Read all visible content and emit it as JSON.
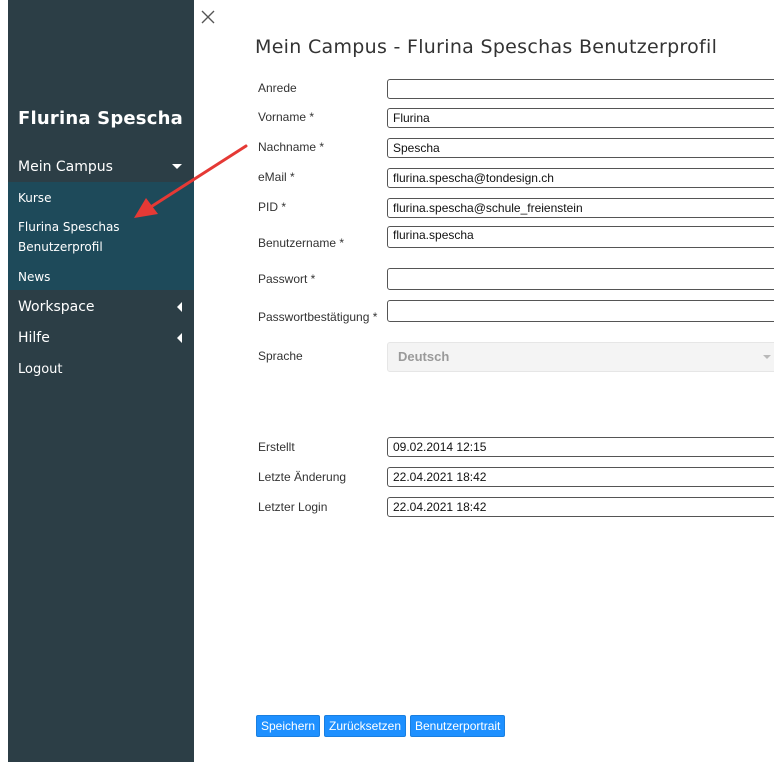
{
  "sidebar": {
    "user_name": "Flurina Spescha",
    "menu": [
      {
        "label": "Mein Campus",
        "expanded": true
      },
      {
        "label": "Kurse"
      },
      {
        "label": "Flurina Speschas Benutzerprofil"
      },
      {
        "label": "News"
      },
      {
        "label": "Workspace",
        "expanded": false
      },
      {
        "label": "Hilfe",
        "expanded": false
      },
      {
        "label": "Logout"
      }
    ]
  },
  "page": {
    "title": "Mein Campus - Flurina Speschas Benutzerprofil"
  },
  "form": {
    "anrede": {
      "label": "Anrede",
      "value": ""
    },
    "vorname": {
      "label": "Vorname *",
      "value": "Flurina"
    },
    "nachname": {
      "label": "Nachname *",
      "value": "Spescha"
    },
    "email": {
      "label": "eMail *",
      "value": "flurina.spescha@tondesign.ch"
    },
    "pid": {
      "label": "PID *",
      "value": "flurina.spescha@schule_freienstein"
    },
    "benutzername": {
      "label": "Benutzername *",
      "value": "flurina.spescha"
    },
    "passwort": {
      "label": "Passwort *",
      "value": ""
    },
    "passwortbestaetigung": {
      "label": "Passwortbestätigung *",
      "value": ""
    },
    "sprache": {
      "label": "Sprache",
      "value": "Deutsch"
    },
    "erstellt": {
      "label": "Erstellt",
      "value": "09.02.2014 12:15"
    },
    "letzte_aenderung": {
      "label": "Letzte Änderung",
      "value": "22.04.2021 18:42"
    },
    "letzter_login": {
      "label": "Letzter Login",
      "value": "22.04.2021 18:42"
    }
  },
  "buttons": {
    "save": "Speichern",
    "reset": "Zurücksetzen",
    "portrait": "Benutzerportrait"
  },
  "colors": {
    "sidebar_bg": "#2c3e46",
    "submenu_bg": "#1e4a5a",
    "button_bg": "#1e90ff",
    "annotation_arrow": "#e53935"
  }
}
